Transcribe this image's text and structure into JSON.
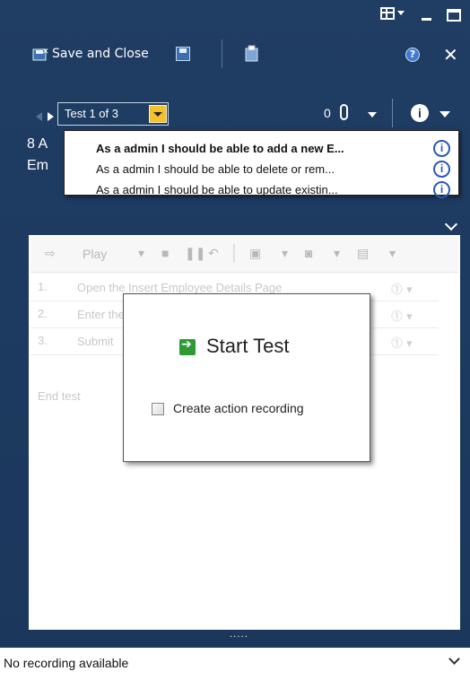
{
  "toolbar": {
    "save_close_label": "Save and Close",
    "help_glyph": "?",
    "close_glyph": "✕",
    "icons": [
      "save-close-icon",
      "save-icon",
      "attach-icon",
      "help-icon",
      "close-icon"
    ]
  },
  "nav": {
    "test_selector": "Test 1 of 3",
    "attachment_count": "0",
    "info_glyph": "i"
  },
  "header": {
    "title_line1": "8 A",
    "title_line2": "Em"
  },
  "dropdown": {
    "items": [
      {
        "label": "As a admin I should be able to add a new E...",
        "selected": true
      },
      {
        "label": "As a admin I should be able to delete or rem...",
        "selected": false
      },
      {
        "label": "As a admin I should be able to update existin...",
        "selected": false
      }
    ],
    "info_glyph": "i"
  },
  "panel": {
    "play_label": "Play",
    "steps": [
      {
        "num": "1.",
        "text": "Open the Insert Employee Details Page"
      },
      {
        "num": "2.",
        "text": "Enter the"
      },
      {
        "num": "3.",
        "text": "Submit"
      }
    ],
    "end_test_label": "End test"
  },
  "start_dialog": {
    "title": "Start Test",
    "checkbox_label": "Create action recording",
    "checkbox_checked": false
  },
  "status": {
    "text": "No recording available",
    "grip": "·····"
  },
  "colors": {
    "window_bg": "#1d3a60",
    "accent_yellow": "#f3c12b",
    "info_blue": "#2a57b5",
    "start_green": "#2e9a35"
  }
}
